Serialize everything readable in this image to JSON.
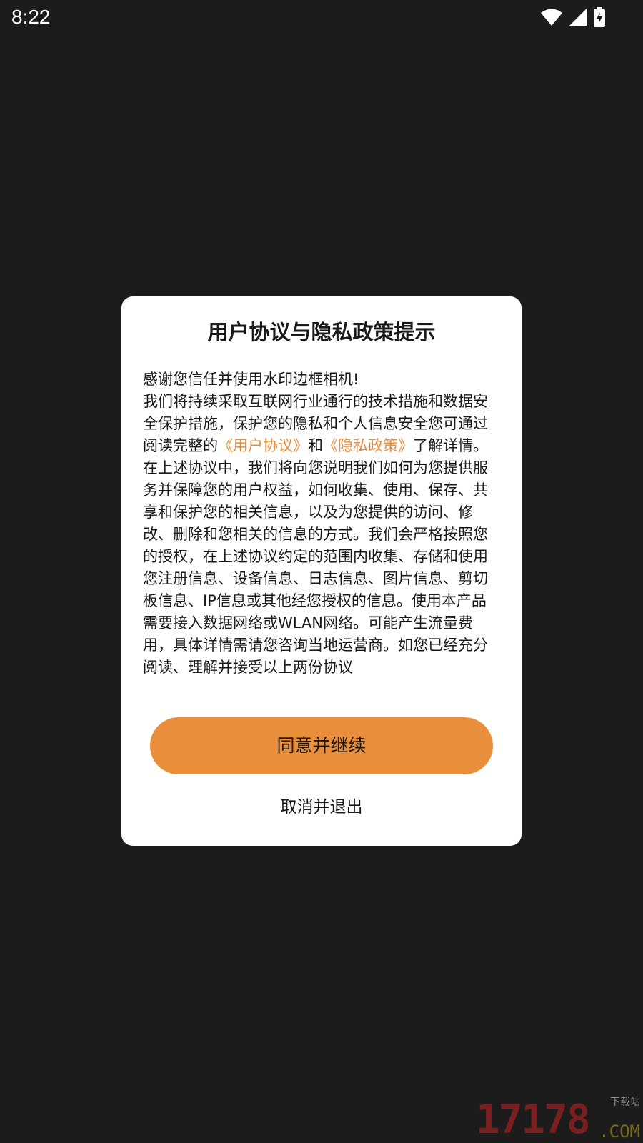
{
  "status_bar": {
    "time": "8:22",
    "icons": [
      "wifi-icon",
      "signal-icon",
      "battery-charging-icon"
    ]
  },
  "dialog": {
    "title": "用户协议与隐私政策提示",
    "intro": "感谢您信任并使用水印边框相机!",
    "para1_before": "我们将持续采取互联网行业通行的技术措施和数据安全保护措施，保护您的隐私和个人信息安全您可通过阅读完整的",
    "user_agreement_link": "《用户协议》",
    "and_text": "和",
    "privacy_policy_link": "《隐私政策》",
    "para1_after": "了解详情。",
    "para2": "在上述协议中，我们将向您说明我们如何为您提供服务并保障您的用户权益，如何收集、使用、保存、共享和保护您的相关信息，以及为您提供的访问、修改、删除和您相关的信息的方式。我们会严格按照您的授权，在上述协议约定的范围内收集、存储和使用您注册信息、设备信息、日志信息、图片信息、剪切板信息、IP信息或其他经您授权的信息。使用本产品需要接入数据网络或WLAN网络。可能产生流量费用，具体详情需请您咨询当地运营商。如您已经充分阅读、理解并接受以上两份协议",
    "agree_label": "同意并继续",
    "cancel_label": "取消并退出"
  },
  "colors": {
    "background": "#1c1c1c",
    "dialog": "#ffffff",
    "accent": "#e98e3b",
    "link": "#e88c3a"
  },
  "watermark": {
    "digits": "17178",
    "small": "下载站",
    "suffix": ".COM"
  }
}
